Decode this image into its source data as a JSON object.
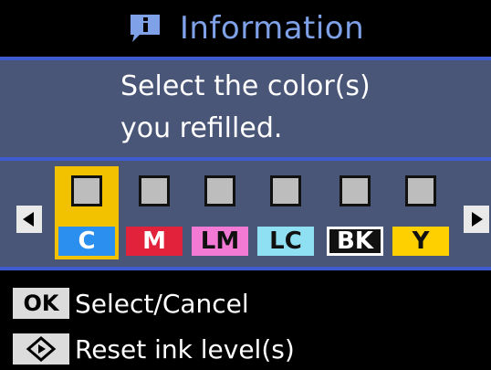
{
  "header": {
    "title": "Information",
    "icon": "info-balloon-icon"
  },
  "message": {
    "line1": "Select the color(s)",
    "line2": "you refilled."
  },
  "inks": [
    {
      "label": "C",
      "selected": true,
      "color": "#2b8ff0"
    },
    {
      "label": "M",
      "selected": false,
      "color": "#e2213a"
    },
    {
      "label": "LM",
      "selected": false,
      "color": "#f27ad4"
    },
    {
      "label": "LC",
      "selected": false,
      "color": "#8fe0f2"
    },
    {
      "label": "BK",
      "selected": false,
      "color": "#111111"
    },
    {
      "label": "Y",
      "selected": false,
      "color": "#ffd000"
    }
  ],
  "options": {
    "ok_key": "OK",
    "ok_text": "Select/Cancel",
    "reset_key_icon": "diamond-start-icon",
    "reset_text": "Reset ink level(s)"
  },
  "colors": {
    "accent_blue": "#3e5bd2",
    "panel": "#4a5677",
    "highlight": "#f2c200",
    "title": "#7ea1e8"
  }
}
